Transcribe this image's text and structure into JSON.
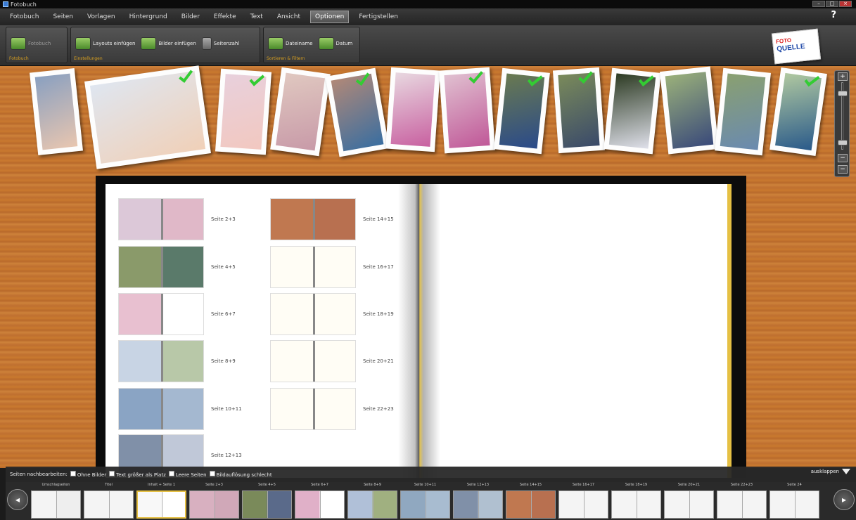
{
  "window": {
    "title": "Fotobuch"
  },
  "menu": {
    "items": [
      "Fotobuch",
      "Seiten",
      "Vorlagen",
      "Hintergrund",
      "Bilder",
      "Effekte",
      "Text",
      "Ansicht",
      "Optionen",
      "Fertigstellen"
    ],
    "active": "Optionen",
    "help": "?"
  },
  "toolbar": {
    "groups": [
      {
        "label": "Fotobuch",
        "buttons": [
          "Fotobuch"
        ]
      },
      {
        "label": "Einstellungen",
        "buttons": [
          "Layouts einfügen",
          "Bilder einfügen",
          "Seitenzahl"
        ]
      },
      {
        "label": "Sortieren & Filtern",
        "buttons": [
          "Dateiname",
          "Datum"
        ]
      }
    ]
  },
  "logo": {
    "line1": "FOTO",
    "line2": "QUELLE"
  },
  "photos": [
    {
      "checked": false,
      "colors": [
        "#8aa0c0",
        "#e8c6b0"
      ]
    },
    {
      "checked": true,
      "colors": [
        "#dfe6f0",
        "#f0d0b8"
      ]
    },
    {
      "checked": true,
      "colors": [
        "#e8d0dc",
        "#f2c8c0"
      ]
    },
    {
      "checked": false,
      "colors": [
        "#e0c8c0",
        "#c89aa8"
      ]
    },
    {
      "checked": true,
      "colors": [
        "#b08878",
        "#3a6ea0"
      ]
    },
    {
      "checked": false,
      "colors": [
        "#e8d8e0",
        "#c860a0"
      ]
    },
    {
      "checked": true,
      "colors": [
        "#e0c0d0",
        "#c05898"
      ]
    },
    {
      "checked": true,
      "colors": [
        "#6a7a50",
        "#2a4a8a"
      ]
    },
    {
      "checked": true,
      "colors": [
        "#7a8a5a",
        "#3a4a6a"
      ]
    },
    {
      "checked": true,
      "colors": [
        "#2c3a22",
        "#dfe0ea"
      ]
    },
    {
      "checked": false,
      "colors": [
        "#9ab07a",
        "#3a4a7a"
      ]
    },
    {
      "checked": false,
      "colors": [
        "#8aa070",
        "#6a8ab0"
      ]
    },
    {
      "checked": true,
      "colors": [
        "#b0c8a0",
        "#2a5a8a"
      ]
    }
  ],
  "zoom": {
    "plus": "+",
    "minus": "−"
  },
  "book": {
    "toc": [
      {
        "label": "Seite 2+3",
        "left": "#dcc8d8",
        "right": "#e0b8c8"
      },
      {
        "label": "Seite 14+15",
        "left": "#c07850",
        "right": "#b87050"
      },
      {
        "label": "Seite 4+5",
        "left": "#8a9a6a",
        "right": "#5a7a6a"
      },
      {
        "label": "Seite 16+17",
        "left": "#fffdf5",
        "right": "#fffdf5"
      },
      {
        "label": "Seite 6+7",
        "left": "#e8c0d0",
        "right": "#ffffff"
      },
      {
        "label": "Seite 18+19",
        "left": "#fffdf5",
        "right": "#fffdf5"
      },
      {
        "label": "Seite 8+9",
        "left": "#c8d4e4",
        "right": "#b8c8a8"
      },
      {
        "label": "Seite 20+21",
        "left": "#fffdf5",
        "right": "#fffdf5"
      },
      {
        "label": "Seite 10+11",
        "left": "#8aa4c4",
        "right": "#a4b8d0"
      },
      {
        "label": "Seite 22+23",
        "left": "#fffdf5",
        "right": "#fffdf5"
      },
      {
        "label": "Seite 12+13",
        "left": "#8090a8",
        "right": "#c0c8d8"
      }
    ]
  },
  "options": {
    "label": "Seiten nachbearbeiten:",
    "checks": [
      "Ohne Bilder",
      "Text größer als Platz",
      "Leere Seiten",
      "Bildauflösung schlecht"
    ],
    "expand": "ausklappen"
  },
  "strip": {
    "slots": [
      {
        "label": "Umschlagseiten",
        "current": false,
        "left": "#f4f4f4",
        "right": "#eeeeee"
      },
      {
        "label": "Titel",
        "current": false,
        "left": "#f4f4f4",
        "right": "#f4f4f4"
      },
      {
        "label": "Inhalt + Seite 1",
        "current": true,
        "left": "#f8f8f8",
        "right": "#ffffff"
      },
      {
        "label": "Seite 2+3",
        "current": false,
        "left": "#d8b0c0",
        "right": "#d0a8b8"
      },
      {
        "label": "Seite 4+5",
        "current": false,
        "left": "#7a8a5a",
        "right": "#5a6a8a"
      },
      {
        "label": "Seite 6+7",
        "current": false,
        "left": "#e0b0c8",
        "right": "#ffffff"
      },
      {
        "label": "Seite 8+9",
        "current": false,
        "left": "#b0c0d8",
        "right": "#a0b080"
      },
      {
        "label": "Seite 10+11",
        "current": false,
        "left": "#90a8c0",
        "right": "#a8bcd0"
      },
      {
        "label": "Seite 12+13",
        "current": false,
        "left": "#8090a8",
        "right": "#b0c0d0"
      },
      {
        "label": "Seite 14+15",
        "current": false,
        "left": "#c07850",
        "right": "#b87050"
      },
      {
        "label": "Seite 16+17",
        "current": false,
        "left": "#f4f4f4",
        "right": "#f4f4f4"
      },
      {
        "label": "Seite 18+19",
        "current": false,
        "left": "#f4f4f4",
        "right": "#f4f4f4"
      },
      {
        "label": "Seite 20+21",
        "current": false,
        "left": "#f4f4f4",
        "right": "#f4f4f4"
      },
      {
        "label": "Seite 22+23",
        "current": false,
        "left": "#f4f4f4",
        "right": "#f4f4f4"
      },
      {
        "label": "Seite 24",
        "current": false,
        "left": "#f4f4f4",
        "right": "#f4f4f4"
      }
    ],
    "prev": "◂",
    "next": "▸"
  },
  "colors": {
    "accent": "#e5c044",
    "wood": "#c9792f",
    "check": "#33cc33",
    "menubar": "#2e2e2e"
  }
}
